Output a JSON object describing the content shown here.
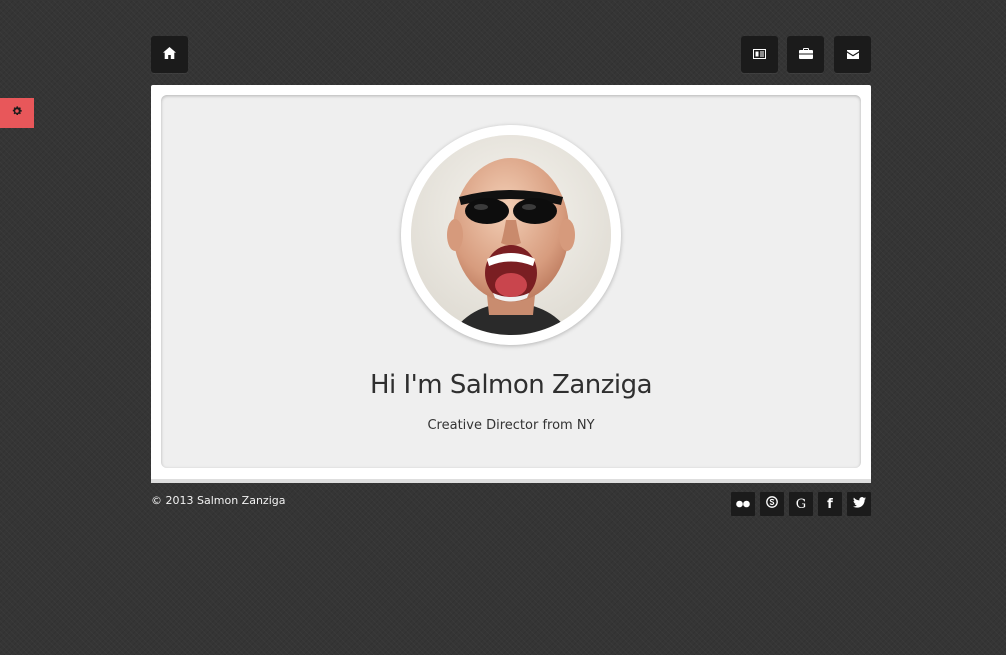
{
  "nav": {
    "home_icon": "home-icon",
    "resume_icon": "resume-card-icon",
    "portfolio_icon": "briefcase-icon",
    "contact_icon": "mail-icon"
  },
  "settings": {
    "icon": "gear-icon",
    "color": "#e8575a"
  },
  "profile": {
    "headline": "Hi I'm Salmon Zanziga",
    "subtitle": "Creative Director from NY"
  },
  "footer": {
    "copyright": "© 2013 Salmon Zanziga",
    "social": [
      {
        "name": "flickr",
        "icon": "flickr-icon"
      },
      {
        "name": "skype",
        "icon": "skype-icon"
      },
      {
        "name": "google",
        "icon": "google-icon",
        "glyph": "G"
      },
      {
        "name": "facebook",
        "icon": "facebook-icon",
        "glyph": "f"
      },
      {
        "name": "twitter",
        "icon": "twitter-icon"
      }
    ]
  },
  "colors": {
    "background": "#353535",
    "button": "#1b1b1b",
    "accent": "#e8575a",
    "card": "#efefef"
  }
}
